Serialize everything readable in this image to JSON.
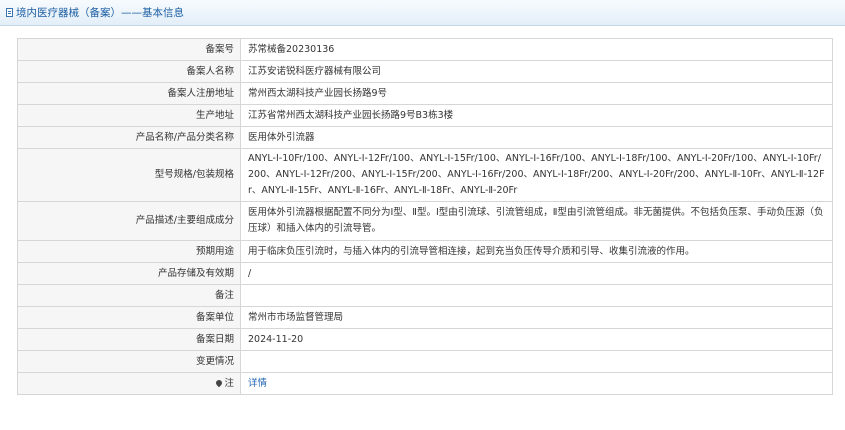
{
  "header": {
    "title": "境内医疗器械（备案）——基本信息"
  },
  "rows": [
    {
      "label": "备案号",
      "value": "苏常械备20230136"
    },
    {
      "label": "备案人名称",
      "value": "江苏安诺锐科医疗器械有限公司"
    },
    {
      "label": "备案人注册地址",
      "value": "常州西太湖科技产业园长扬路9号"
    },
    {
      "label": "生产地址",
      "value": "江苏省常州西太湖科技产业园长扬路9号B3栋3楼"
    },
    {
      "label": "产品名称/产品分类名称",
      "value": "医用体外引流器"
    },
    {
      "label": "型号规格/包装规格",
      "value": "ANYL-Ⅰ-10Fr/100、ANYL-Ⅰ-12Fr/100、ANYL-Ⅰ-15Fr/100、ANYL-Ⅰ-16Fr/100、ANYL-Ⅰ-18Fr/100、ANYL-Ⅰ-20Fr/100、ANYL-Ⅰ-10Fr/200、ANYL-Ⅰ-12Fr/200、ANYL-Ⅰ-15Fr/200、ANYL-Ⅰ-16Fr/200、ANYL-Ⅰ-18Fr/200、ANYL-Ⅰ-20Fr/200、ANYL-Ⅱ-10Fr、ANYL-Ⅱ-12Fr、ANYL-Ⅱ-15Fr、ANYL-Ⅱ-16Fr、ANYL-Ⅱ-18Fr、ANYL-Ⅱ-20Fr"
    },
    {
      "label": "产品描述/主要组成成分",
      "value": "医用体外引流器根据配置不同分为Ⅰ型、Ⅱ型。Ⅰ型由引流球、引流管组成，Ⅱ型由引流管组成。非无菌提供。不包括负压泵、手动负压源（负压球）和插入体内的引流导管。"
    },
    {
      "label": "预期用途",
      "value": "用于临床负压引流时，与插入体内的引流导管相连接，起到充当负压传导介质和引导、收集引流液的作用。"
    },
    {
      "label": "产品存储及有效期",
      "value": "/"
    },
    {
      "label": "备注",
      "value": ""
    },
    {
      "label": "备案单位",
      "value": "常州市市场监督管理局"
    },
    {
      "label": "备案日期",
      "value": "2024-11-20"
    },
    {
      "label": "变更情况",
      "value": ""
    },
    {
      "label": "注",
      "value": "详情"
    }
  ]
}
